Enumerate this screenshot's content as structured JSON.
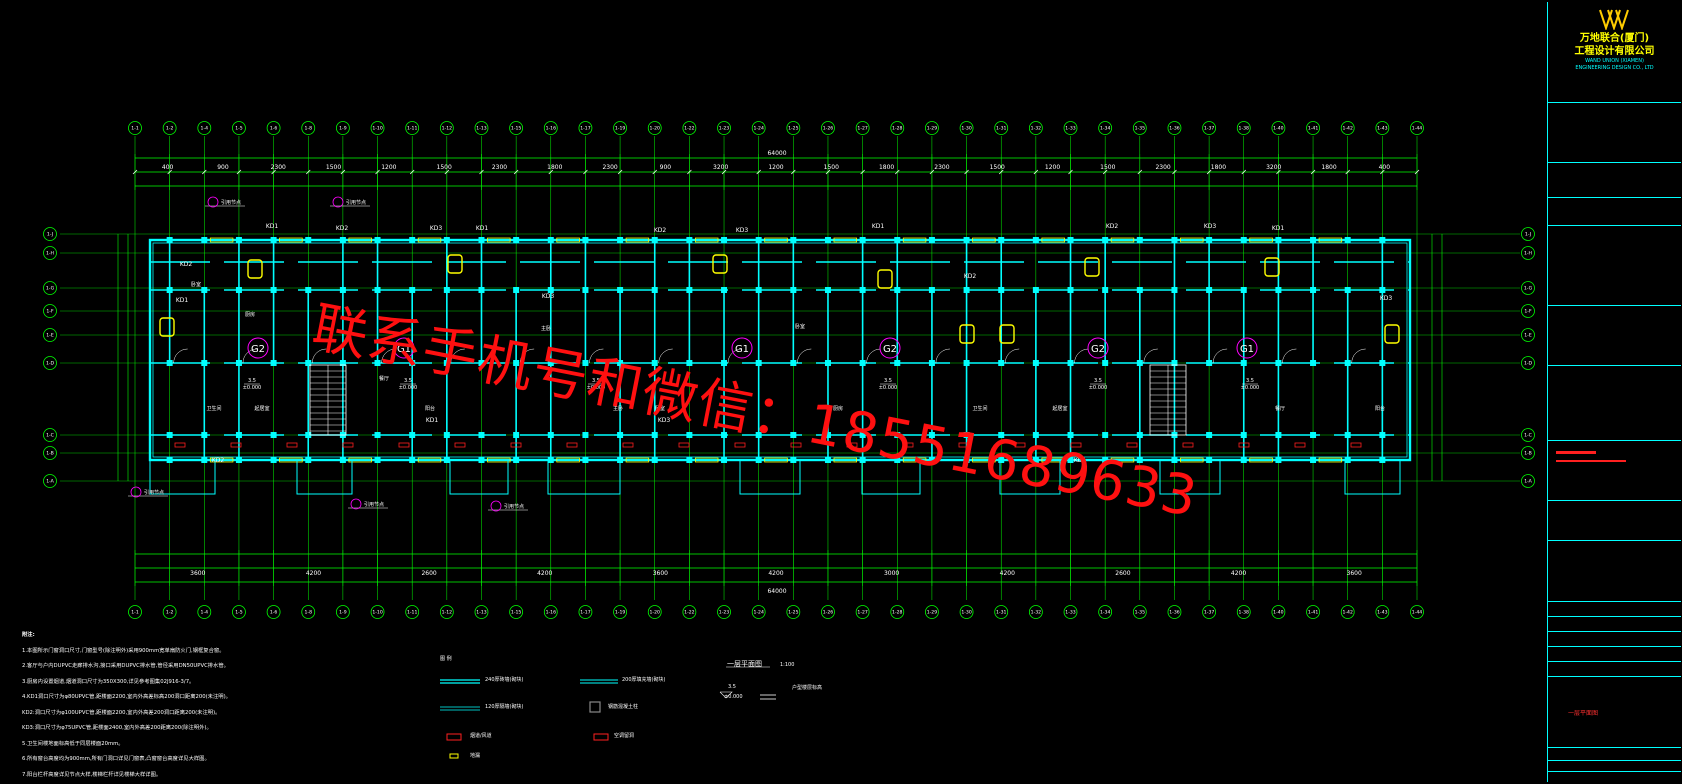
{
  "title_block": {
    "company_cn_1": "万地联合(厦门)",
    "company_cn_2": "工程设计有限公司",
    "company_en_1": "WAND UNION (XIAMEN)",
    "company_en_2": "ENGINEERING DESIGN CO., LTD",
    "sheet_name": "一层平面图"
  },
  "axis_labels": [
    "1-1",
    "1-2",
    "1-4",
    "1-5",
    "1-6",
    "1-8",
    "1-9",
    "1-10",
    "1-11",
    "1-12",
    "1-13",
    "1-15",
    "1-16",
    "1-17",
    "1-19",
    "1-20",
    "1-22",
    "1-23",
    "1-24",
    "1-25",
    "1-26",
    "1-27",
    "1-28",
    "1-29",
    "1-30",
    "1-31",
    "1-32",
    "1-33",
    "1-34",
    "1-35",
    "1-36",
    "1-37",
    "1-38",
    "1-40",
    "1-41",
    "1-42",
    "1-43",
    "1-44"
  ],
  "row_labels_left": [
    "1-J",
    "1-H",
    "1-G",
    "1-F",
    "1-E",
    "1-D",
    "1-C",
    "1-B",
    "1-A"
  ],
  "row_labels_right": [
    "1-J",
    "1-H",
    "1-G",
    "1-F",
    "1-E",
    "1-D",
    "1-C",
    "1-B",
    "1-A"
  ],
  "dim_top_total": "64000",
  "dim_bottom_total": "64000",
  "dim_top_row1": [
    "400",
    "900",
    "2300",
    "1500",
    "1200",
    "1500",
    "2300",
    "1800",
    "2300",
    "900",
    "3200",
    "1200",
    "1500",
    "1800",
    "2300",
    "1500",
    "1200",
    "1500",
    "2300",
    "1800",
    "3200",
    "1800",
    "400"
  ],
  "dim_bottom_row1": [
    "3600",
    "4200",
    "2600",
    "4200",
    "3600",
    "4200",
    "3000",
    "4200",
    "2600",
    "4200",
    "3600"
  ],
  "unit_tags": [
    "G2",
    "G1",
    "G1",
    "G2",
    "G2",
    "G1"
  ],
  "elevation_main": "3.5",
  "elevation_zero": "±0.000",
  "room_labels": [
    "卧室",
    "厨房",
    "卫生间",
    "起居室",
    "餐厅",
    "阳台",
    "主卧"
  ],
  "kd_labels": [
    "KD1",
    "KD2",
    "KD3"
  ],
  "ref_label": "引用节点",
  "notes": {
    "title": "附注:",
    "items": [
      "1.本图所示门窗洞口尺寸,门窗型号(除注明外)采用900mm宽单扇防火门,钢框复合窗。",
      "2.客厅与户内DUPVC走廊排水沟,接口采用DUPVC排水管,管径采用DN50UPVC排水管。",
      "3.厨房内设置烟道,烟道洞口尺寸为350X300,详见参考图集02J916-3/7。",
      "4.KD1洞口尺寸为φ80UPVC管,距楼面2200,室内外高差标高200洞口距离200(未注明)。",
      "  KD2:洞口尺寸为φ100UPVC管,距楼面2200,室内外高差200洞口距离200(未注明)。",
      "  KD3:洞口尺寸为φ75UPVC管,距楼面2400,室内外高差200距离200(除注明外)。",
      "5.卫生间楼地面标高低于同层楼面20mm。",
      "6.所有窗台高度均为900mm,所有门洞口详见门窗表,凸窗窗台高度详见大样图。",
      "7.阳台栏杆高度详见节点大样,楼梯栏杆详见楼梯大样详图。"
    ]
  },
  "legend": {
    "title": "图 例",
    "wall_240": "240厚砖墙(砌块)",
    "wall_200": "200厚填充墙(砌块)",
    "wall_120": "120厚隔墙(砌块)",
    "column": "钢筋混凝土柱",
    "smoke_duct": "烟道/风道",
    "ac_hole": "空调留洞",
    "floor_drain": "地漏"
  },
  "plan_title": "一层平面图",
  "plan_scale": "1:100",
  "elev_legend_value": "3.5",
  "elev_legend_zero": "±0.000",
  "elev_legend_text": "户型楼层标高",
  "watermark": "联系手机号和微信：18551689633",
  "colors": {
    "background": "#000000",
    "wall": "#00ffff",
    "axis": "#00ff00",
    "dims": "#00ff00",
    "window": "#ffff00",
    "fixture": "#ffff00",
    "marker": "#ff00ff",
    "watermark": "#ff1010"
  }
}
